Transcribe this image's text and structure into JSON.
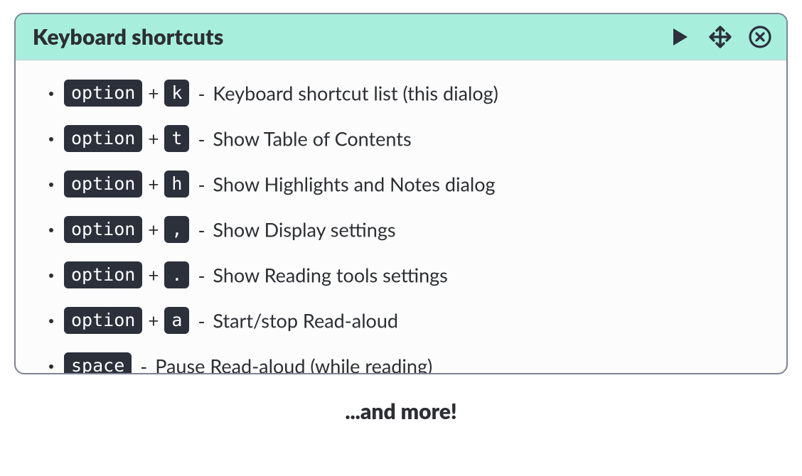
{
  "dialog": {
    "title": "Keyboard shortcuts",
    "plus": "+",
    "dash": "-",
    "shortcuts": [
      {
        "keys": [
          "option",
          "k"
        ],
        "description": "Keyboard shortcut list (this dialog)"
      },
      {
        "keys": [
          "option",
          "t"
        ],
        "description": "Show Table of Contents"
      },
      {
        "keys": [
          "option",
          "h"
        ],
        "description": "Show Highlights and Notes dialog"
      },
      {
        "keys": [
          "option",
          ","
        ],
        "description": "Show Display settings"
      },
      {
        "keys": [
          "option",
          "."
        ],
        "description": "Show Reading tools settings"
      },
      {
        "keys": [
          "option",
          "a"
        ],
        "description": "Start/stop Read-aloud"
      },
      {
        "keys": [
          "space"
        ],
        "description": "Pause Read-aloud (while reading)"
      }
    ]
  },
  "footer": {
    "text": "...and more!"
  }
}
